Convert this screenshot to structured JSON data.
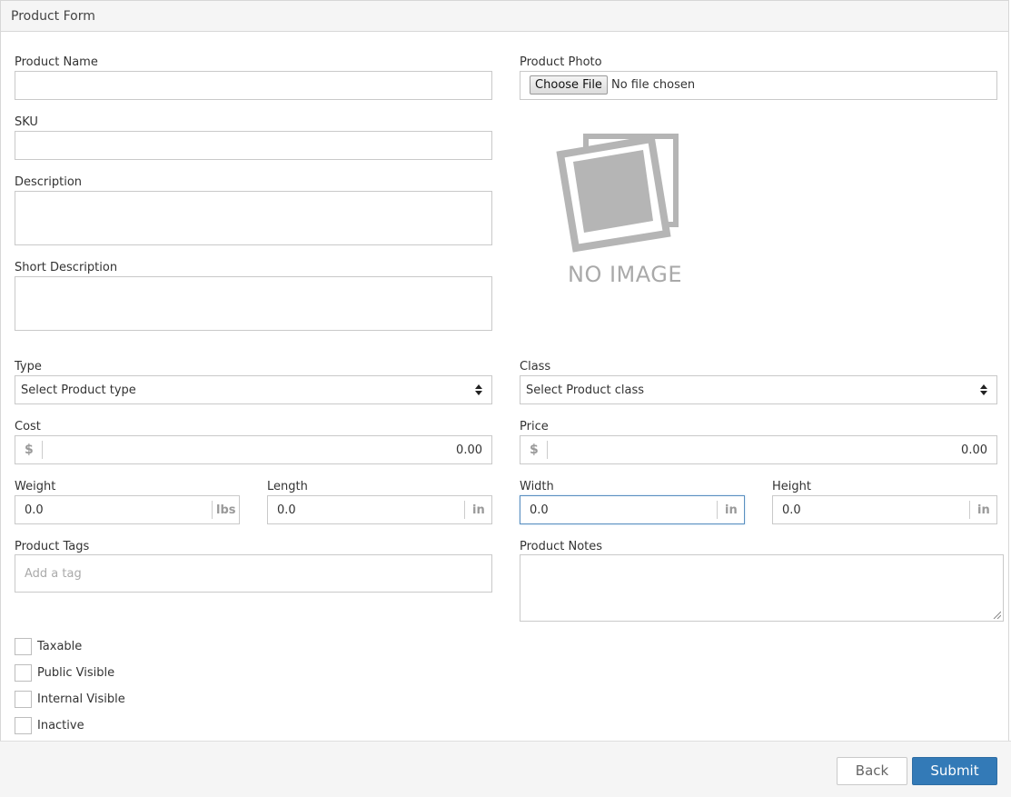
{
  "panel": {
    "title": "Product Form"
  },
  "fields": {
    "product_name": {
      "label": "Product Name",
      "value": ""
    },
    "sku": {
      "label": "SKU",
      "value": ""
    },
    "description": {
      "label": "Description",
      "value": ""
    },
    "short_description": {
      "label": "Short Description",
      "value": ""
    },
    "product_photo": {
      "label": "Product Photo",
      "button": "Choose File",
      "status": "No file chosen",
      "no_image_text": "NO IMAGE"
    },
    "type": {
      "label": "Type",
      "selected": "Select Product type"
    },
    "class": {
      "label": "Class",
      "selected": "Select Product class"
    },
    "cost": {
      "label": "Cost",
      "prefix": "$",
      "value": "0.00"
    },
    "price": {
      "label": "Price",
      "prefix": "$",
      "value": "0.00"
    },
    "weight": {
      "label": "Weight",
      "value": "0.0",
      "unit": "lbs"
    },
    "length": {
      "label": "Length",
      "value": "0.0",
      "unit": "in"
    },
    "width": {
      "label": "Width",
      "value": "0.0",
      "unit": "in"
    },
    "height": {
      "label": "Height",
      "value": "0.0",
      "unit": "in"
    },
    "product_tags": {
      "label": "Product Tags",
      "placeholder": "Add a tag"
    },
    "product_notes": {
      "label": "Product Notes",
      "value": ""
    }
  },
  "checkboxes": [
    {
      "label": "Taxable",
      "checked": false
    },
    {
      "label": "Public Visible",
      "checked": false
    },
    {
      "label": "Internal Visible",
      "checked": false
    },
    {
      "label": "Inactive",
      "checked": false
    }
  ],
  "footer": {
    "back_label": "Back",
    "submit_label": "Submit"
  },
  "colors": {
    "primary": "#337ab7",
    "focus_border": "#5a8fc0",
    "border": "#c9c9c9",
    "heading_bg": "#f5f5f5"
  },
  "icons": {
    "no_image": "photo-placeholder-icon",
    "select": "sort-arrows-icon",
    "resize": "resize-grip-icon"
  }
}
